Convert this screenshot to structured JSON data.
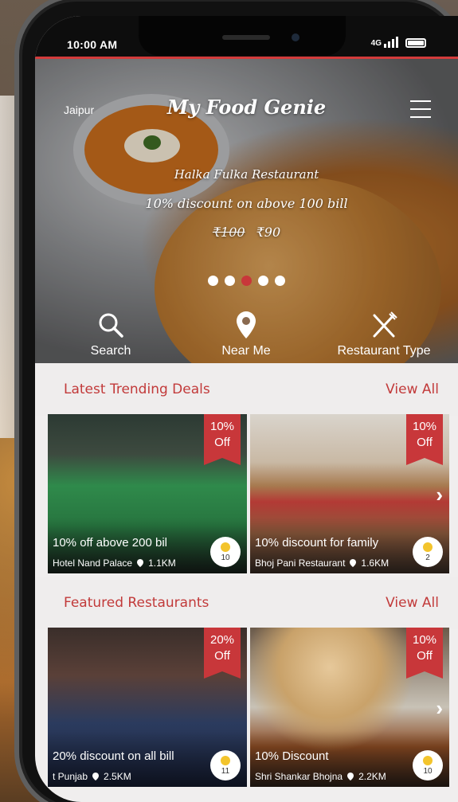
{
  "status_bar": {
    "time": "10:00 AM",
    "network": "4G"
  },
  "header": {
    "city": "Jaipur",
    "logo": "My Food Genie",
    "menu_icon": "hamburger-menu-icon"
  },
  "promo": {
    "restaurant": "Halka Fulka Restaurant",
    "offer": "10% discount on above 100 bill",
    "old_price": "₹100",
    "new_price": "₹90",
    "slides": 5,
    "active_slide": 3
  },
  "actions": [
    {
      "label": "Search",
      "icon": "search-icon"
    },
    {
      "label": "Near Me",
      "icon": "location-pin-icon"
    },
    {
      "label": "Restaurant Type",
      "icon": "fork-knife-icon"
    }
  ],
  "trending": {
    "title": "Latest Trending Deals",
    "view_all": "View All",
    "cards": [
      {
        "discount": "10%",
        "off": "Off",
        "deal": "10% off above 200 bil",
        "name": "Hotel Nand Palace",
        "distance": "1.1KM",
        "rating": "10"
      },
      {
        "discount": "10%",
        "off": "Off",
        "deal": "10% discount for family",
        "name": "Bhoj Pani Restaurant",
        "distance": "1.6KM",
        "rating": "2"
      }
    ]
  },
  "featured": {
    "title": "Featured Restaurants",
    "view_all": "View All",
    "cards": [
      {
        "discount": "20%",
        "off": "Off",
        "deal": "20% discount on all bill",
        "name": "t Punjab",
        "distance": "2.5KM",
        "rating": "11"
      },
      {
        "discount": "10%",
        "off": "Off",
        "deal": "10% Discount",
        "name": "Shri Shankar Bhojna",
        "distance": "2.2KM",
        "rating": "10"
      }
    ]
  },
  "colors": {
    "accent": "#c8373a",
    "section_bg": "#efeded"
  }
}
